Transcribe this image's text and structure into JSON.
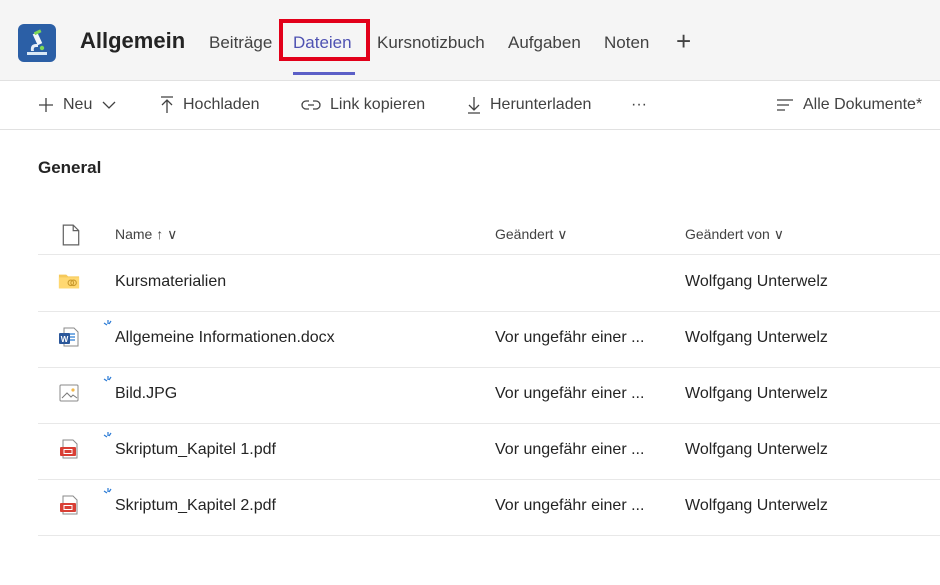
{
  "header": {
    "team_name": "Allgemein",
    "tabs": [
      {
        "label": "Beiträge"
      },
      {
        "label": "Dateien",
        "active": true
      },
      {
        "label": "Kursnotizbuch"
      },
      {
        "label": "Aufgaben"
      },
      {
        "label": "Noten"
      }
    ],
    "add_tab": "+"
  },
  "toolbar": {
    "new_label": "Neu",
    "upload_label": "Hochladen",
    "copy_link_label": "Link kopieren",
    "download_label": "Herunterladen",
    "more_label": "···",
    "view_label": "Alle Dokumente*"
  },
  "section": {
    "title": "General"
  },
  "table": {
    "columns": {
      "name": "Name ↑ ∨",
      "modified": "Geändert ∨",
      "modified_by": "Geändert von ∨"
    },
    "rows": [
      {
        "name": "Kursmaterialien",
        "modified": "",
        "modified_by": "Wolfgang Unterwelz",
        "icon": "folder-icon"
      },
      {
        "name": "Allgemeine Informationen.docx",
        "modified": "Vor ungefähr einer ...",
        "modified_by": "Wolfgang Unterwelz",
        "icon": "word-icon"
      },
      {
        "name": "Bild.JPG",
        "modified": "Vor ungefähr einer ...",
        "modified_by": "Wolfgang Unterwelz",
        "icon": "image-icon"
      },
      {
        "name": "Skriptum_Kapitel 1.pdf",
        "modified": "Vor ungefähr einer ...",
        "modified_by": "Wolfgang Unterwelz",
        "icon": "pdf-icon"
      },
      {
        "name": "Skriptum_Kapitel 2.pdf",
        "modified": "Vor ungefähr einer ...",
        "modified_by": "Wolfgang Unterwelz",
        "icon": "pdf-icon"
      }
    ]
  },
  "colors": {
    "accent": "#5b5fc7",
    "highlight": "#e2001a"
  }
}
